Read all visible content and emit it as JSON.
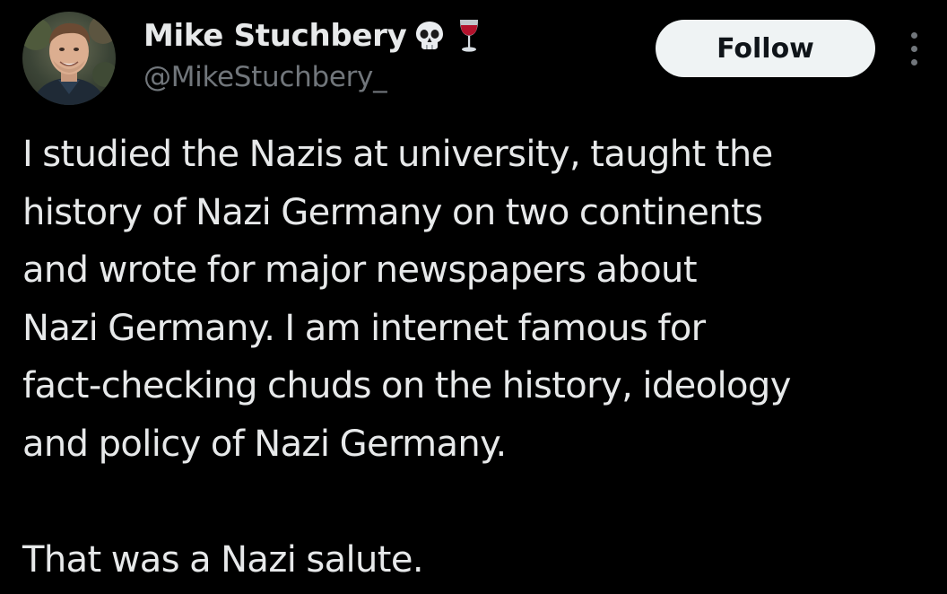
{
  "author": {
    "display_name": "Mike Stuchbery",
    "handle": "@MikeStuchbery_",
    "name_emojis": [
      "skull-emoji",
      "wine-glass-emoji"
    ]
  },
  "actions": {
    "follow_label": "Follow",
    "more_icon": "more-vertical-icon"
  },
  "tweet": {
    "lines": [
      "I studied the Nazis at university, taught the",
      "history of Nazi Germany on two continents",
      "and wrote for major newspapers about",
      "Nazi Germany. I am internet famous for",
      "fact-checking chuds on the history, ideology",
      "and policy of Nazi Germany.",
      "",
      "That was a Nazi salute."
    ]
  },
  "colors": {
    "background": "#000000",
    "primary_text": "#e7e9ea",
    "secondary_text": "#71767b",
    "follow_bg": "#eff3f4",
    "follow_text": "#0f1419"
  }
}
